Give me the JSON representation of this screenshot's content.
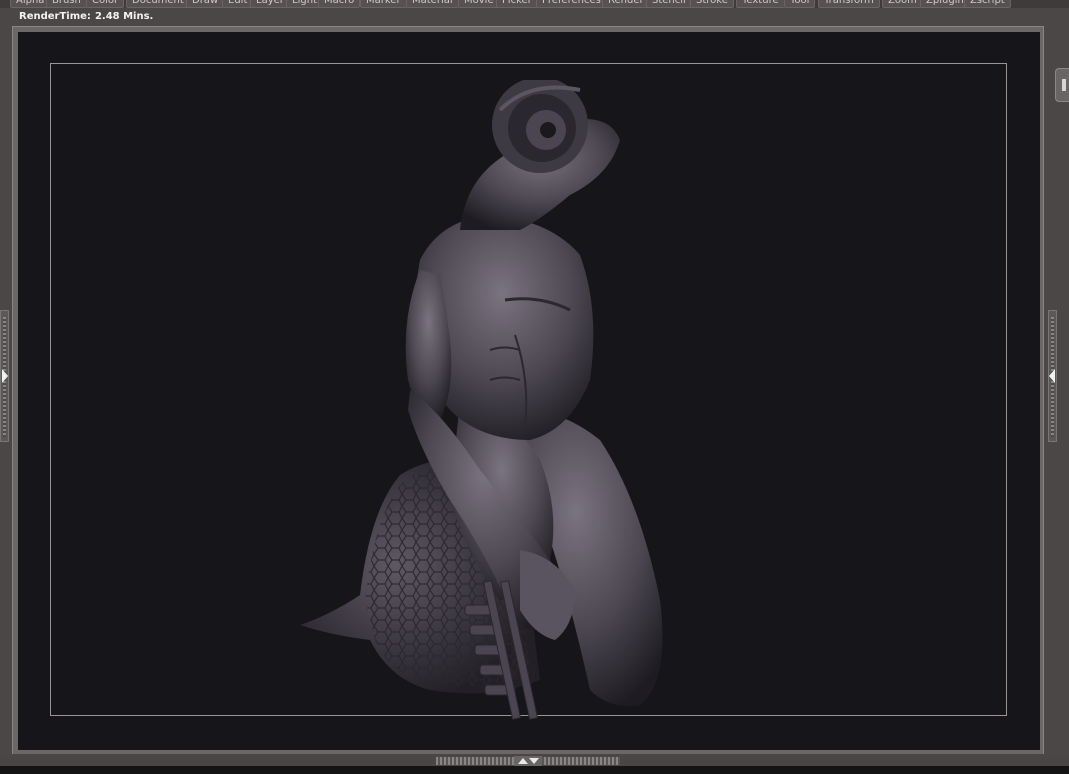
{
  "menu": {
    "items": [
      "Alpha",
      "Brush",
      "Color",
      "Document",
      "Draw",
      "Edit",
      "Layer",
      "Light",
      "Macro",
      "Marker",
      "Material",
      "Movie",
      "Picker",
      "Preferences",
      "Render",
      "Stencil",
      "Stroke",
      "Texture",
      "Tool",
      "Transform",
      "Zoom",
      "Zplugin",
      "Zscript"
    ]
  },
  "status": {
    "label": "RenderTime:",
    "value": "2.48 Mins."
  },
  "canvas": {
    "background_color": "#161519",
    "frame_color": "#6c6767",
    "model_color": "#4d4852"
  },
  "icons": {
    "left_tray": "tray-expand-arrow-icon",
    "right_tray": "tray-expand-arrow-icon",
    "bottom_tray": "tray-toggle-arrows-icon"
  }
}
